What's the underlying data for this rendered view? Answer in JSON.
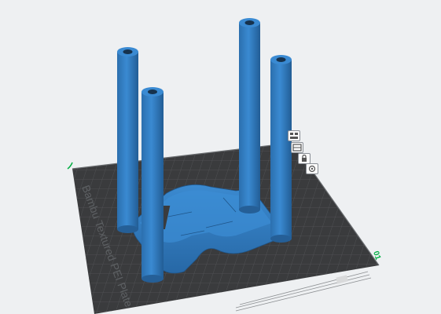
{
  "viewport": {
    "plate_label": "Bambu Textured PEI Plate",
    "plate_number": "01",
    "axis_marker": "⤴",
    "colors": {
      "background": "#eef0f2",
      "plate": "#3b3c3e",
      "grid_line": "#56585b",
      "model": "#2f78b8",
      "model_light": "#3a8ad2",
      "model_dark": "#215a90",
      "accent_green": "#00ae42"
    }
  },
  "plate_toolbar": {
    "items": [
      {
        "name": "arrange-objects-icon"
      },
      {
        "name": "orient-objects-icon"
      },
      {
        "name": "lock-plate-icon"
      },
      {
        "name": "plate-settings-icon"
      }
    ]
  }
}
